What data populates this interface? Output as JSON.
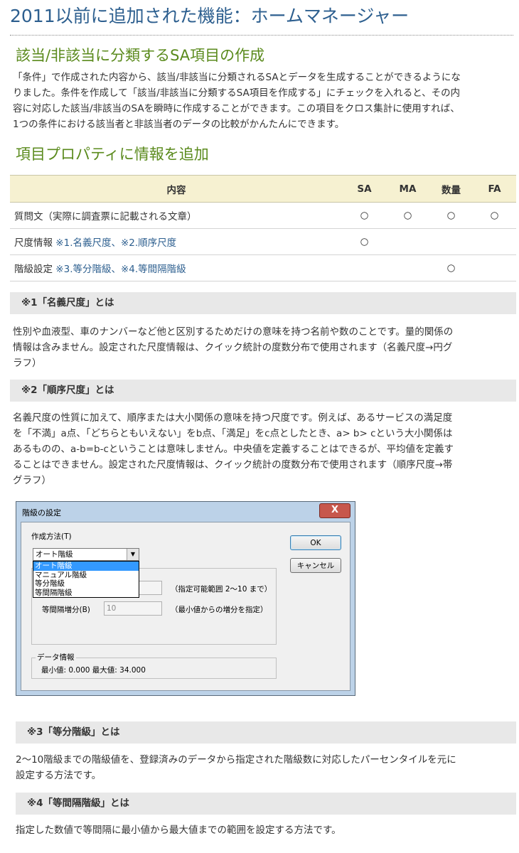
{
  "page": {
    "title": "2011以前に追加された機能：ホームマネージャー"
  },
  "section1": {
    "heading": "該当/非該当に分類するSA項目の作成",
    "lines": [
      "「条件」で作成された内容から、該当/非該当に分類されるSAとデータを生成することができるようにな",
      "りました。条件を作成して「該当/非該当に分類するSA項目を作成する」にチェックを入れると、その内",
      "容に対応した該当/非該当のSAを瞬時に作成することができます。この項目をクロス集計に使用すれば、",
      "1つの条件における該当者と非該当者のデータの比較がかんたんにできます。"
    ]
  },
  "section2": {
    "heading": "項目プロパティに情報を追加",
    "table": {
      "headers": [
        "内容",
        "SA",
        "MA",
        "数量",
        "FA"
      ],
      "rows": [
        {
          "label": "質問文（実際に調査票に記載される文章）",
          "note": "",
          "sa": "○",
          "ma": "○",
          "qty": "○",
          "fa": "○"
        },
        {
          "label": "尺度情報 ",
          "note": "※1.名義尺度、※2.順序尺度",
          "sa": "○",
          "ma": "",
          "qty": "",
          "fa": ""
        },
        {
          "label": "階級設定 ",
          "note": "※3.等分階級、※4.等間隔階級",
          "sa": "",
          "ma": "",
          "qty": "○",
          "fa": ""
        }
      ]
    }
  },
  "note1": {
    "heading": "※1「名義尺度」とは",
    "lines": [
      "性別や血液型、車のナンバーなど他と区別するためだけの意味を持つ名前や数のことです。量的関係の",
      "情報は含みません。設定された尺度情報は、クイック統計の度数分布で使用されます（名義尺度→円グ",
      "ラフ）"
    ]
  },
  "note2": {
    "heading": "※2「順序尺度」とは",
    "lines": [
      "名義尺度の性質に加えて、順序または大小関係の意味を持つ尺度です。例えば、あるサービスの満足度",
      "を「不満」a点、「どちらともいえない」をb点、「満足」をc点としたとき、a> b> cという大小関係は",
      "あるものの、a-b=b-cということは意味しません。中央値を定義することはできるが、平均値を定義す",
      "ることはできません。設定された尺度情報は、クイック統計の度数分布で使用されます（順序尺度→帯",
      "グラフ）"
    ]
  },
  "dialog": {
    "title": "階級の設定",
    "close": "X",
    "method_label": "作成方法(T)",
    "combo_value": "オート階級",
    "combo_arrow": "▼",
    "options": [
      "オート階級",
      "マニュアル階級",
      "等分階級",
      "等間隔階級"
    ],
    "range_hint": "（指定可能範囲 2～10 まで）",
    "increment_label": "等間隔増分(B)",
    "increment_value": "10",
    "increment_hint": "（最小値からの増分を指定）",
    "data_group": "データ情報",
    "data_summary": "最小値: 0.000  最大値: 34.000",
    "ok": "OK",
    "cancel": "キャンセル"
  },
  "note3": {
    "heading": "※3「等分階級」とは",
    "lines": [
      "2～10階級までの階級値を、登録済みのデータから指定された階級数に対応したパーセンタイルを元に",
      "設定する方法です。"
    ]
  },
  "note4": {
    "heading": "※4「等間隔階級」とは",
    "lines": [
      "指定した数値で等間隔に最小値から最大値までの範囲を設定する方法です。"
    ]
  },
  "colors": {
    "title": "#2d5f8f",
    "section_heading": "#5a8a1c",
    "table_header_bg": "#f6f1d1",
    "note_head_bg": "#e8e8e8",
    "link_note": "#2d5f8f"
  }
}
